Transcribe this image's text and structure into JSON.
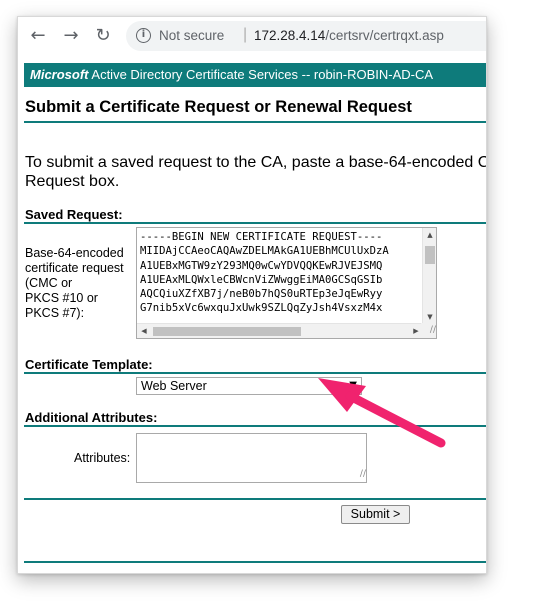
{
  "browser": {
    "back_icon": "arrow-left-icon",
    "forward_icon": "arrow-right-icon",
    "reload_icon": "reload-icon",
    "security_label": "Not secure",
    "url_host": "172.28.4.14",
    "url_path": "/certsrv/certrqxt.asp"
  },
  "banner": {
    "brand": "Microsoft",
    "text": " Active Directory Certificate Services  --  robin-ROBIN-AD-CA"
  },
  "page": {
    "title": "Submit a Certificate Request or Renewal Request",
    "intro_line1": "To submit a saved request to the CA, paste a base-64-encoded C",
    "intro_line2": "Request box."
  },
  "saved_request": {
    "section_label": "Saved Request:",
    "field_label_lines": [
      "Base-64-encoded",
      "certificate request",
      "(CMC or",
      "PKCS #10 or",
      "PKCS #7):"
    ],
    "value": "-----BEGIN NEW CERTIFICATE REQUEST----\nMIIDAjCCAeoCAQAwZDELMAkGA1UEBhMCUlUxDzA\nA1UEBxMGTW9zY293MQ0wCwYDVQQKEwRJVEJSMQ\nA1UEAxMLQWxleCBWcnViZWwggEiMA0GCSqGSIb\nAQCQiuXZfXB7j/neB0b7hQS0uRTEp3eJqEwRyy\nG7nib5xVc6wxquJxUwk9SZLQqZyJsh4VsxzM4x"
  },
  "template": {
    "section_label": "Certificate Template:",
    "selected": "Web Server"
  },
  "additional": {
    "section_label": "Additional Attributes:",
    "attributes_label": "Attributes:",
    "attributes_value": ""
  },
  "actions": {
    "submit_label": "Submit >"
  },
  "colors": {
    "accent": "#0e7b7b",
    "annotation_arrow": "#f0236e"
  }
}
